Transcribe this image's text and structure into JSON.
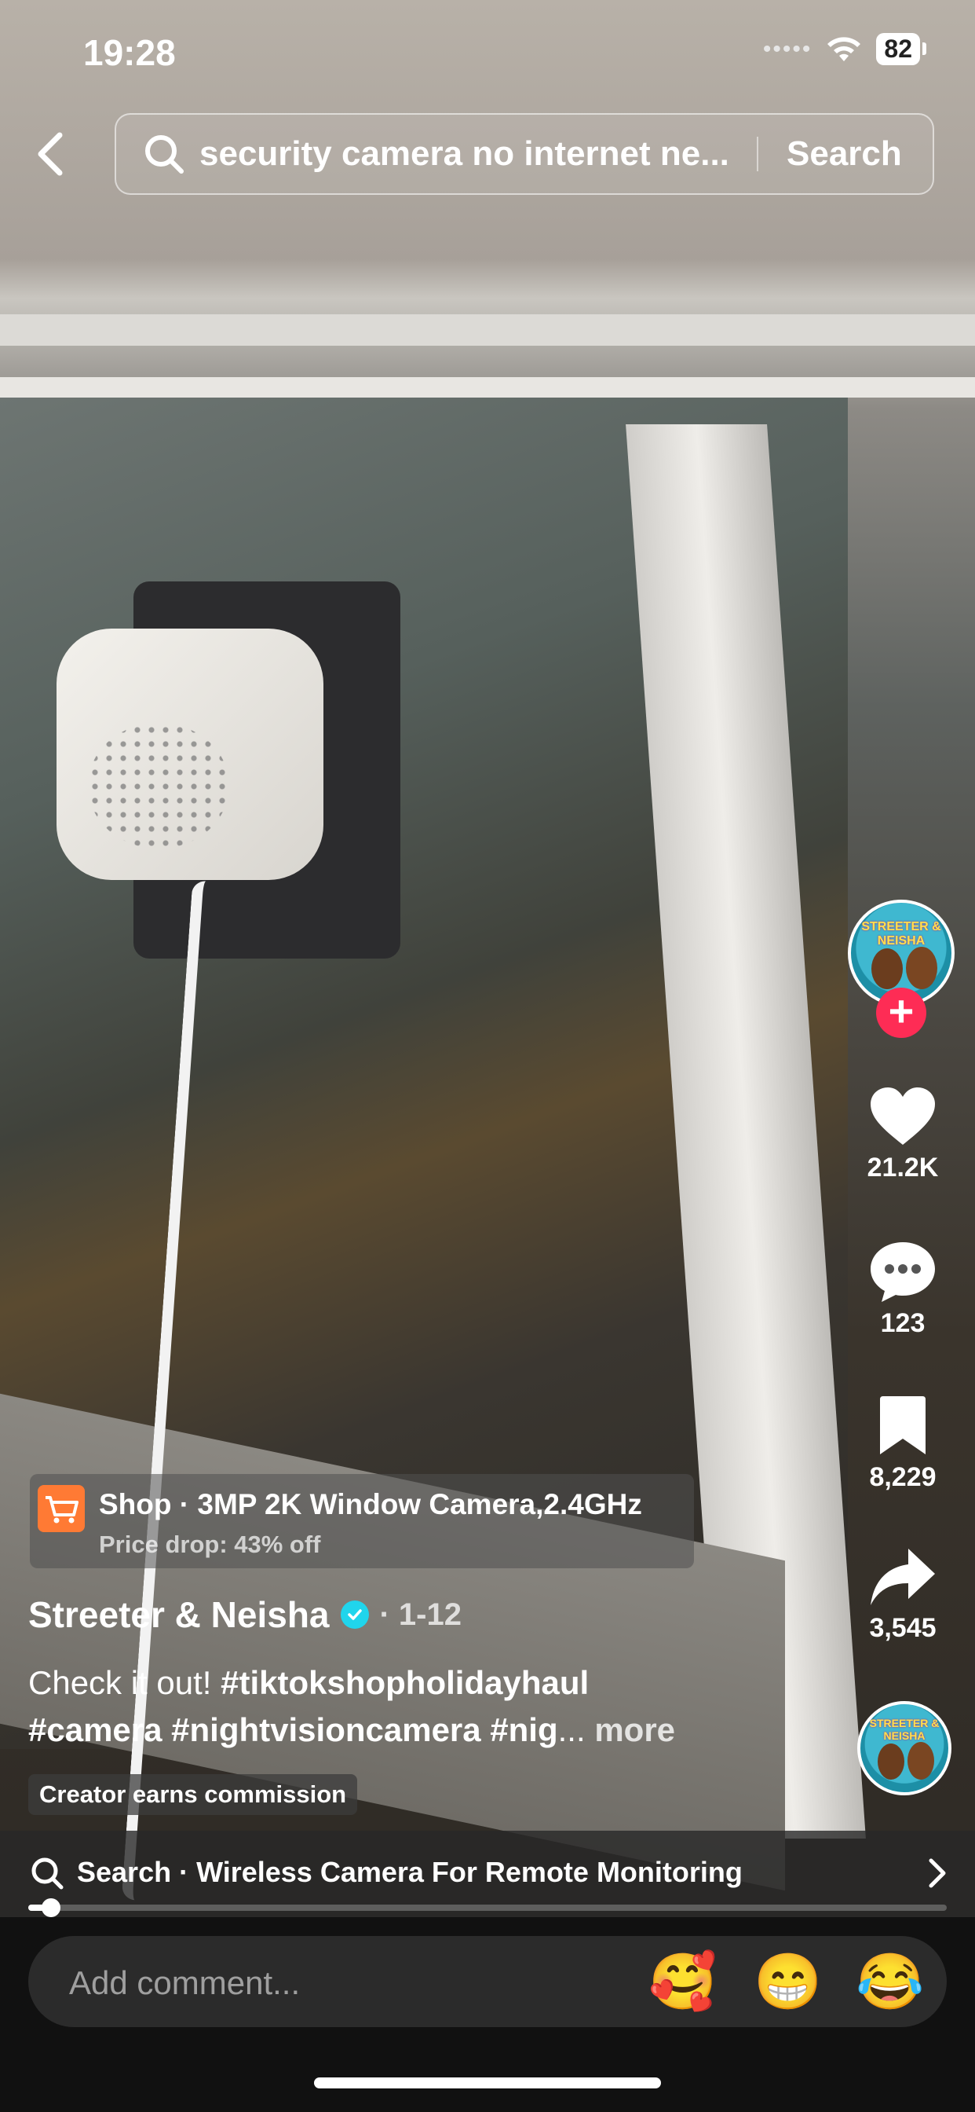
{
  "status_bar": {
    "time": "19:28",
    "signal": "•••••",
    "battery": "82"
  },
  "search": {
    "query": "security camera no internet ne...",
    "button_label": "Search"
  },
  "actions": {
    "likes": "21.2K",
    "comments": "123",
    "saves": "8,229",
    "shares": "3,545"
  },
  "avatar_text": "STREETER & NEISHA",
  "shop": {
    "title": "Shop · 3MP 2K Window Camera,2.4GHz",
    "subtitle": "Price drop: 43% off"
  },
  "post": {
    "author": "Streeter & Neisha",
    "date": "· 1-12",
    "caption_text": "Check it out! ",
    "hashtag1": "#tiktokshopholidayhaul",
    "hashtag2": "#camera",
    "hashtag3": "#nightvisioncamera",
    "hashtag4": "#nig",
    "ellipsis": "...",
    "more": "more",
    "commission": "Creator earns commission"
  },
  "related_search": {
    "text": "Search · Wireless Camera For Remote Monitoring"
  },
  "playback": {
    "progress_fraction": 0.025
  },
  "comment": {
    "placeholder": "Add comment...",
    "emojis": [
      "🥰",
      "😁",
      "😂"
    ]
  },
  "colors": {
    "accent": "#fe2c55",
    "verified": "#20d5ec",
    "shop_icon": "#ff7a34"
  }
}
